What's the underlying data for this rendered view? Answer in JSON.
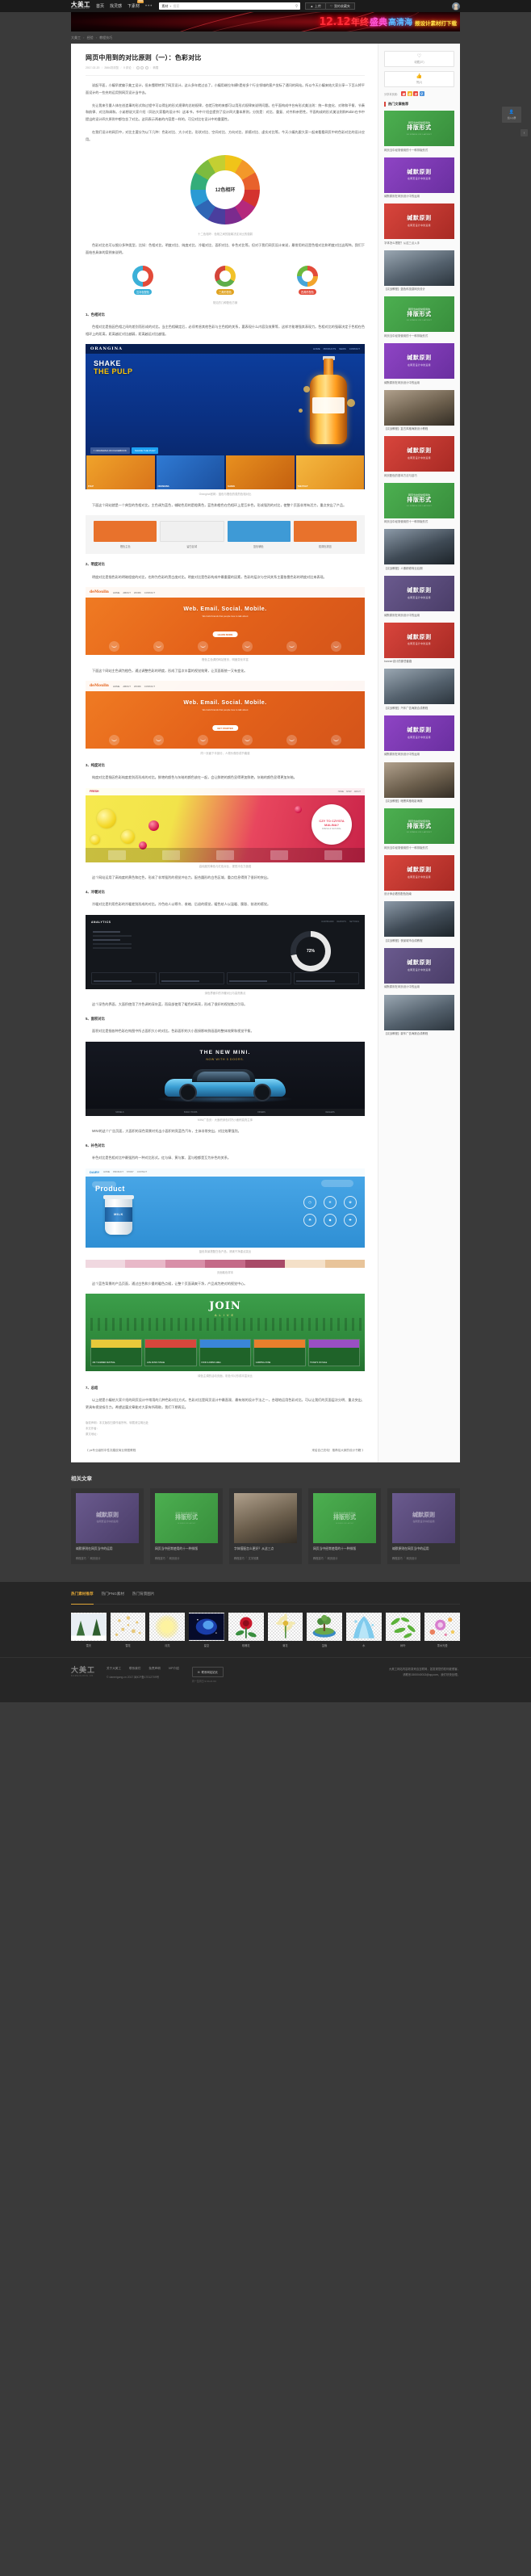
{
  "site": {
    "name_cn": "大美工",
    "name_en": "DAMEIGONG.CN"
  },
  "topnav": {
    "items": [
      {
        "label": "首页",
        "badge": ""
      },
      {
        "label": "找灵感",
        "badge": ""
      },
      {
        "label": "下素材",
        "badge": "NEW"
      },
      {
        "label": "•••",
        "badge": ""
      }
    ],
    "search": {
      "category": "素材",
      "separator": "▾",
      "placeholder": "搜索",
      "icon": "search-icon"
    },
    "buttons": [
      {
        "label": "上传",
        "icon": "upload-icon"
      },
      {
        "label": "我的收藏夹",
        "icon": "heart-icon"
      }
    ],
    "avatar": "user-avatar"
  },
  "banner": {
    "n1": "12.12",
    "n2": "年终",
    "n3": "盛典",
    "n4": "高清海",
    "n5": "报设计素材打下载"
  },
  "breadcrumb": {
    "items": [
      "大美工",
      "经验",
      "教程技巧"
    ],
    "separator": "›"
  },
  "article": {
    "title": "网页中用到的对比原则（一）：色彩对比",
    "meta": {
      "date": "2017-02-20",
      "views": "2664次浏览",
      "comments": "0 评论",
      "share_label": "转载",
      "icons": [
        "weibo-icon",
        "wechat-icon",
        "qzone-icon"
      ]
    },
    "paragraphs": [
      "说起平面，小编早就偏于美工设计，但未懂得转到了网页设计，这么多年就过去了，小编用继拉车横h是给多个行业领域的客户坐标了通讯的网站。所以今天小编来结大家分享一下怎么将平面设计的一些充的运用到网页设计当中去。",
      "先让我来引量人体在创造事的形式和过程中可以得出的形式规律的总结规律，也就万物的来都可以用形式规律来说明问题。在平面构成中台有形式美法则：统一和变化、对称和平衡、节奏和韵律、对比和调和。小弟想说大家介绍（同治大家看的设计书）这本书，书中介绍会提到了设计四大重本原则，分别是：对比、重复、对齐和亲密性。平面构成的形式美法则和Robin在书中提出的设计四大原则中都包含了对比。这同表示两者的内容是一样的，可见对比在设计中的重要性。",
      "在我们设计的网页中，对比主要分为以下几种：色彩对比、大小对比、形状对比、空间对比、方向对比、质感对比、虚实对比等。今天小编先跟大家一起来看看网页中的色彩对比的设计应用。",
      "色彩对比也可以细分多种类型，比如：色相对比、明度对比、纯度对比、冷暖对比、面积对比、补色对比等。但对于我们网页设计来说，最常用的还是色相对比和明度对比这两种。我们下面结合具体的案例来说明。"
    ],
    "sections": [
      {
        "heading": "1、色相对比",
        "paras": [
          "色相对比是指因色相之间的差别而形成的对比。当主色相确定后，必须考虑其他色彩与主色相的关系，要表现什么内容及效果等，这样才能增强其表现力。色相对比的强弱决定于色相在色相环上的距离，距离越近对比越弱，距离越远对比越强。",
          "下面这个网站就是一个典型的色相对比，主色调为蓝色，辅助色用的是橙黄色，蓝色和橙色在色相环上是互补色，形成强烈的对比，使整个页面非常有活力，重点突出了产品。"
        ]
      },
      {
        "heading": "2、明度对比",
        "paras": [
          "明度对比是指色彩的明暗程度的对比，也称为色彩的黑白度对比。明度对比是色彩构成中最重要的因素，色彩的层次与空间关系主要依靠色彩的明度对比来表现。",
          "下面这个网站主色调为橙色，通过调整色彩的明度，形成了层次丰富的视觉效果，让页面既统一又有变化。"
        ]
      },
      {
        "heading": "3、纯度对比",
        "paras": [
          "纯度对比是指因色彩纯度差别而形成的对比。鲜艳的颜色与灰暗的颜色放在一起，会让鲜艳的颜色显得更加鲜艳，灰暗的颜色显得更加灰暗。",
          "这个网站运用了高纯度的黄色和红色，形成了非常强烈的视觉冲击力，配合圆形的白色区域，重点信息得到了很好的突出。"
        ]
      },
      {
        "heading": "4、冷暖对比",
        "paras": [
          "冷暖对比是利用色彩的冷暖差别形成的对比。冷色给人以寒冷、收缩、后退的感觉，暖色给人以温暖、膨胀、前进的感觉。",
          "这个深色的界面，大面积使用了冷色调的深灰蓝，而局部使用了暖色的高亮，形成了很好的视觉焦点引导。"
        ]
      },
      {
        "heading": "5、面积对比",
        "paras": [
          "面积对比是指各种色彩在构图中所占面积大小的对比。色彩面积的大小直接影响到画面的整体效果和视觉平衡。",
          "MINI的这个广告页面，大面积的深色背景衬托出小面积的亮蓝色汽车，主体非常突出，对比效果强烈。"
        ]
      },
      {
        "heading": "6、补色对比",
        "paras": [
          "补色对比是色相对比中最强烈的一种对比形式。红与绿、黄与紫、蓝与橙都是互为补色的关系。",
          "这个蓝色背景的产品页面，通过白色和少量的暖色点缀，让整个页面清爽干净，产品成为绝对的视觉中心。"
        ]
      },
      {
        "heading": "7、总结",
        "paras": [
          "以上就是小编给大家介绍的网页设计中常用的几种色彩对比方式。色彩对比是网页设计中最直观、最有效的设计手法之一，合理地运用色彩对比，可以让我们的页面层次分明、重点突出、更具有视觉吸引力。希望这篇文章能对大家有所帮助，我们下期再见。"
        ]
      }
    ],
    "figures": {
      "donut": {
        "label": "12色相环",
        "caption": "十二色相环：色相之间的距离决定对比的强弱"
      },
      "pies": {
        "items": [
          {
            "tag": "互补色配色",
            "cls": "a"
          },
          {
            "tag": "三角形配色",
            "cls": "b"
          },
          {
            "tag": "四角形配色",
            "cls": "c"
          }
        ],
        "caption": "常见的几种配色方案"
      },
      "orangina": {
        "logo": "ORANGINA",
        "nav": [
          "HOME",
          "PRODUCTS",
          "NEWS",
          "CONTACT"
        ],
        "headline1": "SHAKE",
        "headline2": "THE PULP",
        "social_fb": "ORANGINA ON FACEBOOK",
        "social_tw": "SHAKE THE PULP",
        "cards": [
          "PULP",
          "ORANGINA",
          "SHAKE",
          "THE PULP"
        ],
        "caption": "Orangina官网：蓝色与橙色的强烈色相对比"
      },
      "bars": {
        "items": [
          {
            "label": "橙色主色",
            "cls": "bl1"
          },
          {
            "label": "留白区域",
            "cls": "bl2"
          },
          {
            "label": "蓝色辅色",
            "cls": "bl3"
          },
          {
            "label": "强调色按钮",
            "cls": "bl4"
          }
        ],
        "caption": "页面主要色彩构成比例示意"
      },
      "orange1": {
        "logo": "deMoulin",
        "nav": [
          "HOME",
          "ABOUT",
          "WORK",
          "CONTACT"
        ],
        "headline": "Web. Email. Social. Mobile.",
        "sub": "We build brands that people love to talk about",
        "button": "LEARN MORE",
        "caption": "橙色主色调的网站首页，明度变化丰富"
      },
      "orange2": {
        "logo": "deMoulin",
        "nav": [
          "HOME",
          "ABOUT",
          "WORK",
          "CONTACT"
        ],
        "headline": "Web. Email. Social. Mobile.",
        "sub": "We build brands that people love to talk about",
        "button": "GET STARTED",
        "caption": "同一页面下半部分，人物头像形成节奏感"
      },
      "lemon": {
        "logo": "FRESH",
        "nav": [
          "HOME",
          "SHOP",
          "ABOUT"
        ],
        "badge_line1": "CZY TO CZYSTA MALINA?",
        "badge_line2": "FRESH & NATURAL",
        "caption": "高纯度的黄色与红色对比，视觉冲击力极强"
      },
      "darkui": {
        "logo": "ANALYTICS",
        "nav": [
          "DASHBOARD",
          "REPORTS",
          "SETTINGS"
        ],
        "ring_value": "72%",
        "caption": "深色界面中的冷暖对比与高亮焦点"
      },
      "mini": {
        "headline": "THE NEW MINI.",
        "sub": "NOW WITH 5 DOORS.",
        "nav": [
          "MODELS",
          "BUILD YOURS",
          "OFFERS",
          "DEALERS"
        ],
        "caption": "MINI广告页：大面积深色衬托小面积高亮主体"
      },
      "blue": {
        "logo": "DAIRY",
        "nav": [
          "HOME",
          "PRODUCT",
          "STORY",
          "CONTACT"
        ],
        "title": "Product",
        "cup_text": "MILK",
        "icons": [
          "◷",
          "❄",
          "✿",
          "☘",
          "◆",
          "✚"
        ],
        "caption": "蓝色背景搭配白色产品，清爽干净重点突出"
      },
      "swatches": {
        "colors": [
          "#f0d8e0",
          "#e8b8c8",
          "#d88fa8",
          "#c46a88",
          "#a84a68",
          "#f4e0c8",
          "#e8c49a"
        ],
        "caption": "页面取色样本"
      },
      "green": {
        "title": "JOIN",
        "sub": "ALIVE",
        "cards": [
          {
            "t": "2017 SUMMER FESTIVAL",
            "cls": "gc1"
          },
          {
            "t": "LIVE MUSIC STAGE",
            "cls": "gc2"
          },
          {
            "t": "FOOD & DRINK AREA",
            "cls": "gc3"
          },
          {
            "t": "CAMPING ZONE",
            "cls": "gc4"
          },
          {
            "t": "TICKETS ON SALE",
            "cls": "gc5"
          }
        ],
        "caption": "绿色主调的活动页面，彩色卡片形成丰富对比"
      }
    },
    "footer_notes": [
      "版权声明：本文版权归原作者所有，转载请注明出处",
      "本文作者：",
      "原文地址："
    ],
    "pager": {
      "prev": "《 ps专业级别中性灰磨皮商业修图教程",
      "next": "来给自己充电！推荐给大家的设计书籍 》"
    }
  },
  "sidebar": {
    "collect": {
      "icon": "heart-icon",
      "label": "收藏(37)"
    },
    "like": {
      "icon": "thumbsup-icon",
      "label": "赞(2)"
    },
    "share": {
      "label": "分享本页到：",
      "icons": [
        {
          "name": "weibo-share-icon",
          "glyph": "微",
          "cls": "si1"
        },
        {
          "name": "wechat-share-icon",
          "glyph": "信",
          "cls": "si2"
        },
        {
          "name": "qzone-share-icon",
          "glyph": "空",
          "cls": "si3"
        },
        {
          "name": "qq-share-icon",
          "glyph": "Q",
          "cls": "si4"
        }
      ]
    },
    "hot_title": "热门文章推荐",
    "hot_items": [
      {
        "kind": "text",
        "cls": "tg",
        "pre": "网页当中经常使用的",
        "tt": "排版形式",
        "en": "14 KINDS OF LAYOUT",
        "title": "网页当中经常使用的十一种排版形式"
      },
      {
        "kind": "text",
        "cls": "tp",
        "pre": "",
        "tt": "缄默原则",
        "st": "在网页设计中的运用",
        "en": "",
        "title": "缄默原则在网页设计中的运用"
      },
      {
        "kind": "text",
        "cls": "tr",
        "pre": "",
        "tt": "缄默原则",
        "st": "在网页设计中的运用",
        "en": "",
        "title": "字体怎么搭配？从这三点入手"
      },
      {
        "kind": "photo",
        "cls": "photoA",
        "title": "【实战教程】蓝色科技感网页设计"
      },
      {
        "kind": "text",
        "cls": "tg",
        "pre": "网页当中经常使用的",
        "tt": "排版形式",
        "en": "14 KINDS OF LAYOUT",
        "title": "网页当中经常使用的十一种排版形式"
      },
      {
        "kind": "text",
        "cls": "tp",
        "pre": "",
        "tt": "缄默原则",
        "st": "在网页设计中的运用",
        "en": "",
        "title": "缄默原则在网页设计中的运用"
      },
      {
        "kind": "photo",
        "cls": "photoB",
        "title": "【实战教程】复古风格海报设计教程"
      },
      {
        "kind": "text",
        "cls": "tr",
        "pre": "",
        "tt": "缄默原则",
        "st": "在网页设计中的运用",
        "en": "",
        "title": "网页配色的基本方法与技巧"
      },
      {
        "kind": "text",
        "cls": "tg",
        "pre": "网页当中经常使用的",
        "tt": "排版形式",
        "en": "14 KINDS OF LAYOUT",
        "title": "网页当中经常使用的十一种排版形式"
      },
      {
        "kind": "photo",
        "cls": "photoC",
        "title": "【实战教程】人像精修商业后期"
      },
      {
        "kind": "text",
        "cls": "tv",
        "pre": "",
        "tt": "缄默原则",
        "st": "在网页设计中的运用",
        "en": "",
        "title": "缄默原则在网页设计中的运用"
      },
      {
        "kind": "text",
        "cls": "tr",
        "pre": "",
        "tt": "缄默原则",
        "st": "在网页设计中的运用",
        "en": "",
        "title": "banner设计的那些套路"
      },
      {
        "kind": "photo",
        "cls": "photoA",
        "title": "【实战教程】汽车广告海报合成教程"
      },
      {
        "kind": "text",
        "cls": "tp",
        "pre": "",
        "tt": "缄默原则",
        "st": "在网页设计中的运用",
        "en": "",
        "title": "缄默原则在网页设计中的运用"
      },
      {
        "kind": "photo",
        "cls": "photoB",
        "title": "【实战教程】暗黑风格电影海报"
      },
      {
        "kind": "text",
        "cls": "tg",
        "pre": "网页当中经常使用的",
        "tt": "排版形式",
        "en": "14 KINDS OF LAYOUT",
        "title": "网页当中经常使用的十一种排版形式"
      },
      {
        "kind": "text",
        "cls": "tr",
        "pre": "",
        "tt": "缄默原则",
        "st": "在网页设计中的运用",
        "en": "",
        "title": "设计师必看的配色指南"
      },
      {
        "kind": "photo",
        "cls": "photoC",
        "title": "【实战教程】夜景城市合成教程"
      },
      {
        "kind": "text",
        "cls": "tv",
        "pre": "",
        "tt": "缄默原则",
        "st": "在网页设计中的运用",
        "en": "",
        "title": "缄默原则在网页设计中的运用"
      },
      {
        "kind": "photo",
        "cls": "photoA",
        "title": "【实战教程】豪车广告海报合成教程"
      }
    ]
  },
  "related": {
    "title": "相关文章",
    "items": [
      {
        "cls": "tv",
        "pre": "",
        "tt": "缄默原则",
        "st": "在网页设计中的运用",
        "en": "",
        "title": "缄默原则在网页当中的运用",
        "tags": [
          "教程技巧",
          "网页设计"
        ]
      },
      {
        "cls": "tg",
        "pre": "网页当中经常使用的",
        "tt": "排版形式",
        "st": "",
        "en": "14 KINDS OF LAYOUT",
        "title": "网页当中经常使用的十一种排版",
        "tags": [
          "教程技巧",
          "网页设计"
        ]
      },
      {
        "cls": "photoB",
        "pre": "",
        "tt": "",
        "st": "",
        "en": "",
        "title": "字体搭配怎么更好？从这三点",
        "tags": [
          "教程技巧",
          "文字效果"
        ]
      },
      {
        "cls": "tg",
        "pre": "网页当中经常使用的",
        "tt": "排版形式",
        "st": "",
        "en": "14 KINDS OF LAYOUT",
        "title": "网页当中经常使用的十一种排版",
        "tags": [
          "教程技巧",
          "网页设计"
        ]
      },
      {
        "cls": "tv",
        "pre": "",
        "tt": "缄默原则",
        "st": "在网页设计中的运用",
        "en": "",
        "title": "缄默原则在网页当中的运用",
        "tags": [
          "教程技巧",
          "网页设计"
        ]
      }
    ]
  },
  "footer_tabs": {
    "tabs": [
      {
        "label": "热门素材推荐",
        "active": true
      },
      {
        "label": "热门PNG素材",
        "active": false
      },
      {
        "label": "热门背景图片",
        "active": false
      }
    ],
    "thumbs": [
      {
        "name": "雪天",
        "kind": "snow"
      },
      {
        "name": "雪花",
        "kind": "snowflake"
      },
      {
        "name": "月亮",
        "kind": "moon"
      },
      {
        "name": "星空",
        "kind": "nebula"
      },
      {
        "name": "玫瑰花",
        "kind": "rose"
      },
      {
        "name": "菊花",
        "kind": "daisy"
      },
      {
        "name": "盆栽",
        "kind": "bonsai"
      },
      {
        "name": "水",
        "kind": "water"
      },
      {
        "name": "树叶",
        "kind": "leaf"
      },
      {
        "name": "墨水光晕",
        "kind": "bokeh"
      }
    ]
  },
  "footer": {
    "links": [
      "关于大美工",
      "联系我们",
      "免责声明",
      "VIP介绍"
    ],
    "copyright": "© dameigong.cn 2017 闽ICP备17012709号",
    "contact_btn": {
      "icon": "service-icon",
      "label": "联系网站站长"
    },
    "hours": "周一至周日 9:00-21:00",
    "notice_line1": "大美工网站内容收录来自互联网，如发现您的权利被侵害，",
    "notice_line2": "请联系1500040013@qq.com，我们尽快处理。"
  },
  "floating": {
    "qq": {
      "icon": "qq-icon",
      "label": "加入Q群"
    },
    "backtop": {
      "icon": "arrow-up-icon",
      "label": "↑"
    }
  }
}
